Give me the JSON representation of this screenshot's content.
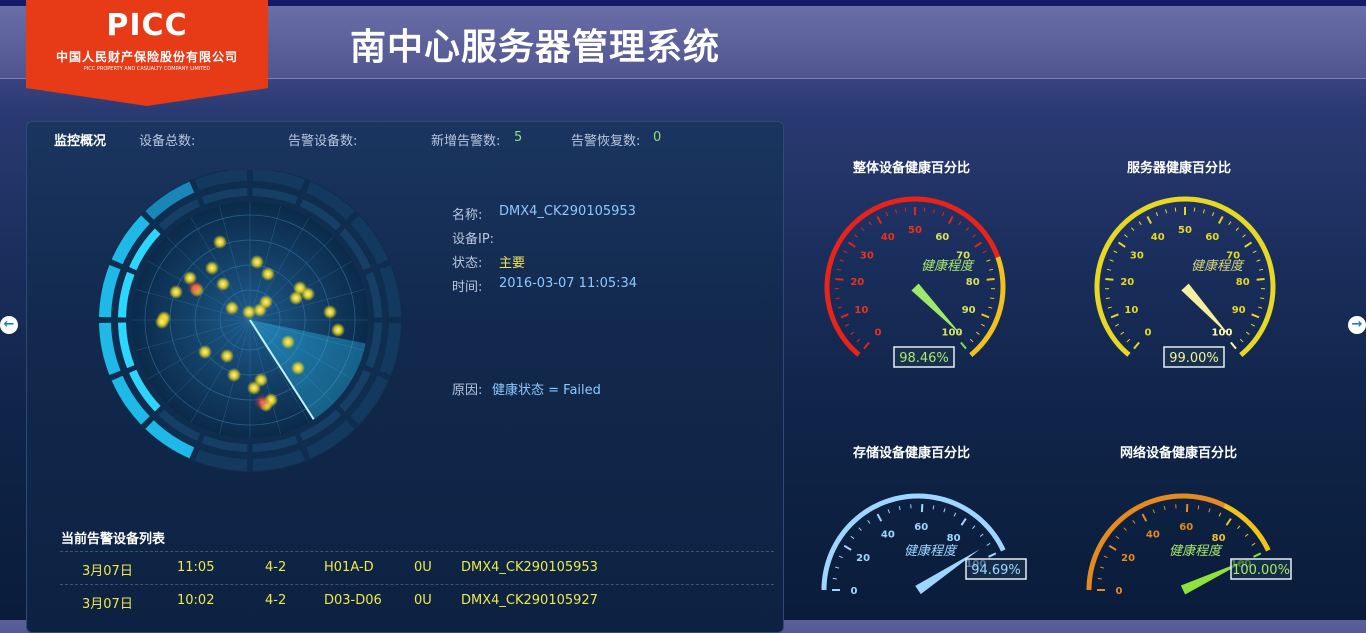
{
  "logo": {
    "mark": "PICC",
    "name_cn": "中国人民财产保险股份有限公司",
    "name_en": "PICC PROPERTY AND CASUALTY COMPANY LIMITED",
    "color": "#e63b16"
  },
  "app_title": "南中心服务器管理系统",
  "summary": {
    "title": "监控概况",
    "total_label": "设备总数:",
    "alarm_label": "告警设备数:",
    "new_label": "新增告警数:",
    "new_value": "5",
    "recovered_label": "告警恢复数:",
    "recovered_value": "0"
  },
  "detail": {
    "name_label": "名称:",
    "name_value": "DMX4_CK290105953",
    "ip_label": "设备IP:",
    "status_label": "状态:",
    "status_value": "主要",
    "time_label": "时间:",
    "time_value": "2016-03-07 11:05:34",
    "reason_label": "原因:",
    "reason_value": "健康状态 = Failed"
  },
  "alarm_list": {
    "title": "当前告警设备列表",
    "rows": [
      [
        "3月07日",
        "11:05",
        "4-2",
        "H01A-D",
        "0U",
        "DMX4_CK290105953"
      ],
      [
        "3月07日",
        "10:02",
        "4-2",
        "D03-D06",
        "0U",
        "DMX4_CK290105927"
      ]
    ]
  },
  "gauges": [
    {
      "title": "整体设备健康百分比",
      "label": "健康程度",
      "value": 98.46,
      "value_text": "98.46%",
      "ticks": [
        "0",
        "10",
        "20",
        "30",
        "40",
        "50",
        "60",
        "70",
        "80",
        "90",
        "100"
      ],
      "type": "full",
      "style": "multi"
    },
    {
      "title": "服务器健康百分比",
      "label": "健康程度",
      "value": 99.0,
      "value_text": "99.00%",
      "ticks": [
        "0",
        "10",
        "20",
        "30",
        "40",
        "50",
        "60",
        "70",
        "80",
        "90",
        "100"
      ],
      "type": "full",
      "style": "yellow"
    },
    {
      "title": "存储设备健康百分比",
      "label": "健康程度",
      "value": 94.69,
      "value_text": "94.69%",
      "ticks": [
        "0",
        "20",
        "40",
        "60",
        "80",
        "100"
      ],
      "type": "half",
      "style": "blue"
    },
    {
      "title": "网络设备健康百分比",
      "label": "健康程度",
      "value": 100.0,
      "value_text": "100.00%",
      "ticks": [
        "0",
        "20",
        "40",
        "60",
        "80",
        "100"
      ],
      "type": "half",
      "style": "orange"
    }
  ],
  "icons": {
    "left_arrow": "arrow-left-icon",
    "right_arrow": "arrow-right-icon"
  }
}
